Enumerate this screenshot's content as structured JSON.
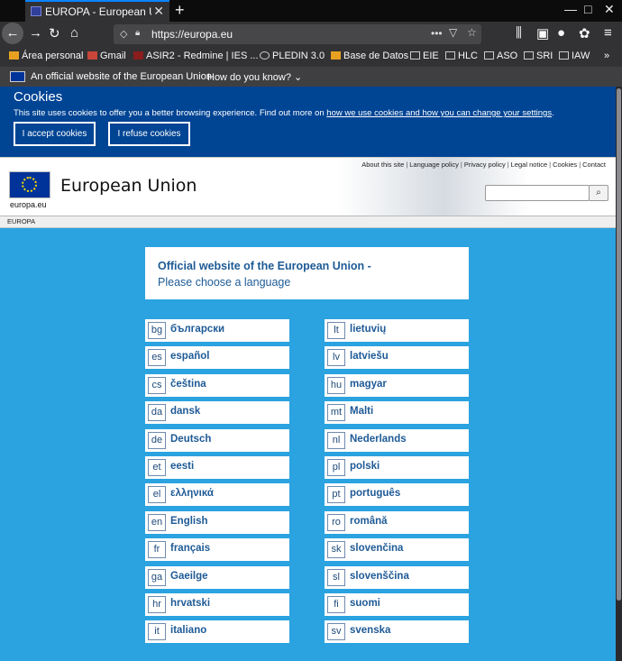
{
  "browser": {
    "tab_title": "EUROPA - European Union",
    "url": "https://europa.eu",
    "bookmarks": [
      {
        "label": "Área personal",
        "icon": "moodle-icon"
      },
      {
        "label": "Gmail",
        "icon": "gmail-icon"
      },
      {
        "label": "ASIR2 - Redmine | IES ...",
        "icon": "redmine-icon"
      },
      {
        "label": "PLEDIN 3.0",
        "icon": "globe-icon"
      },
      {
        "label": "Base de Datos",
        "icon": "moodle-icon"
      },
      {
        "label": "EIE",
        "icon": "folder-icon"
      },
      {
        "label": "HLC",
        "icon": "folder-icon"
      },
      {
        "label": "ASO",
        "icon": "folder-icon"
      },
      {
        "label": "SRI",
        "icon": "folder-icon"
      },
      {
        "label": "IAW",
        "icon": "folder-icon"
      }
    ],
    "more_bookmarks": "»"
  },
  "official_bar": {
    "text": "An official website of the European Union",
    "how": "How do you know?"
  },
  "cookie": {
    "title": "Cookies",
    "text_before": "This site uses cookies to offer you a better browsing experience. Find out more on ",
    "link_text": "how we use cookies and how you can change your settings",
    "text_after": ".",
    "accept": "I accept cookies",
    "refuse": "I refuse cookies"
  },
  "header": {
    "links": [
      "About this site",
      "Language policy",
      "Privacy policy",
      "Legal notice",
      "Cookies",
      "Contact"
    ],
    "logo_text": "europa.eu",
    "brand": "European Union",
    "breadcrumb": "EUROPA"
  },
  "welcome": {
    "line1": "Official website of the European Union -",
    "line2": "Please choose a language"
  },
  "languages_left": [
    {
      "code": "bg",
      "name": "български"
    },
    {
      "code": "es",
      "name": "español"
    },
    {
      "code": "cs",
      "name": "čeština"
    },
    {
      "code": "da",
      "name": "dansk"
    },
    {
      "code": "de",
      "name": "Deutsch"
    },
    {
      "code": "et",
      "name": "eesti"
    },
    {
      "code": "el",
      "name": "ελληνικά"
    },
    {
      "code": "en",
      "name": "English"
    },
    {
      "code": "fr",
      "name": "français"
    },
    {
      "code": "ga",
      "name": "Gaeilge"
    },
    {
      "code": "hr",
      "name": "hrvatski"
    },
    {
      "code": "it",
      "name": "italiano"
    }
  ],
  "languages_right": [
    {
      "code": "lt",
      "name": "lietuvių"
    },
    {
      "code": "lv",
      "name": "latviešu"
    },
    {
      "code": "hu",
      "name": "magyar"
    },
    {
      "code": "mt",
      "name": "Malti"
    },
    {
      "code": "nl",
      "name": "Nederlands"
    },
    {
      "code": "pl",
      "name": "polski"
    },
    {
      "code": "pt",
      "name": "português"
    },
    {
      "code": "ro",
      "name": "română"
    },
    {
      "code": "sk",
      "name": "slovenčina"
    },
    {
      "code": "sl",
      "name": "slovenščina"
    },
    {
      "code": "fi",
      "name": "suomi"
    },
    {
      "code": "sv",
      "name": "svenska"
    }
  ],
  "colors": {
    "cookie_bg": "#004494",
    "page_bg": "#2aa3e0",
    "link_blue": "#1e5a96"
  }
}
